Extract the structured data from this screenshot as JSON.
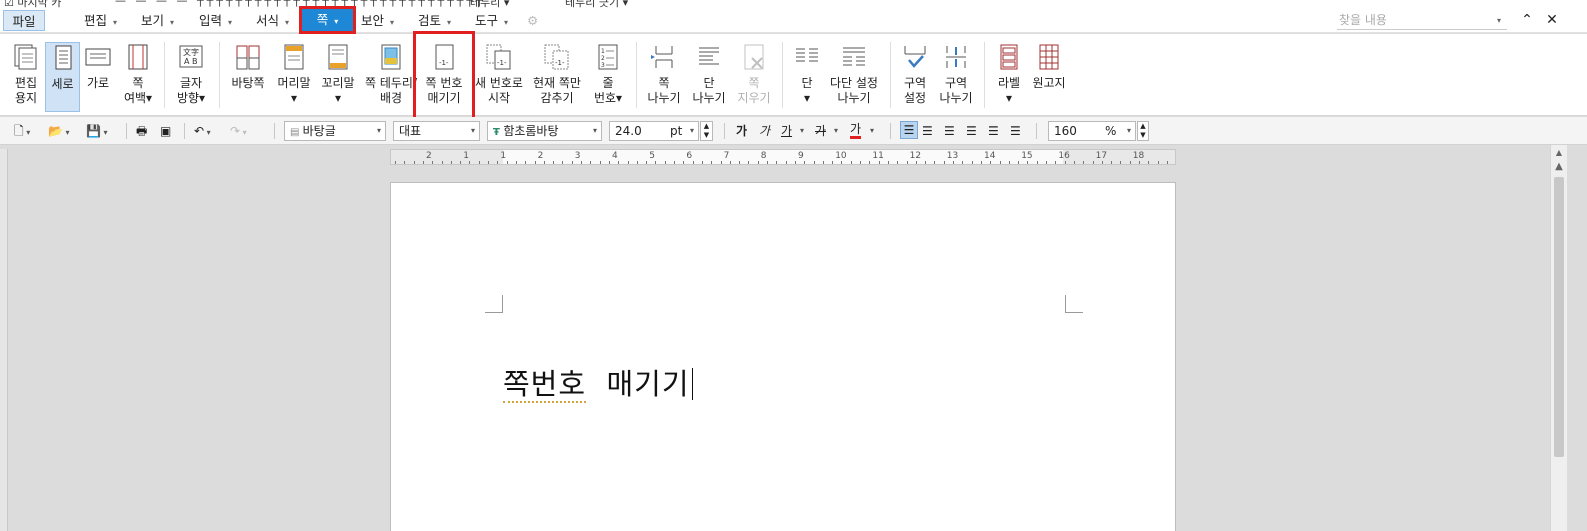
{
  "topstrip": {
    "left_text": "마지막 카",
    "mid_text": "테두리 ▾",
    "right_text": "테두리 긋기 ▾"
  },
  "menubar": {
    "file": "파일",
    "items": [
      {
        "label": "편집"
      },
      {
        "label": "보기"
      },
      {
        "label": "입력"
      },
      {
        "label": "서식"
      },
      {
        "label": "쪽"
      },
      {
        "label": "보안"
      },
      {
        "label": "검토"
      },
      {
        "label": "도구"
      }
    ],
    "search_placeholder": "찾을 내용",
    "dropdown_glyph": "▾",
    "collapse_glyph": "⌃",
    "close_glyph": "✕"
  },
  "ribbon": {
    "edit_paper": [
      "편집",
      "용지"
    ],
    "sero": "세로",
    "garo": "가로",
    "margin": [
      "쪽",
      "여백▾"
    ],
    "text_dir": [
      "글자",
      "방향▾"
    ],
    "batang": "바탕쪽",
    "header": [
      "머리말",
      "▾"
    ],
    "footer": [
      "꼬리말",
      "▾"
    ],
    "border_bg": [
      "쪽 테두리/",
      "배경"
    ],
    "page_num": [
      "쪽 번호",
      "매기기"
    ],
    "new_num": [
      "새 번호로",
      "시작"
    ],
    "hide_cur": [
      "현재 쪽만",
      "감추기"
    ],
    "line_num": [
      "줄",
      "번호▾"
    ],
    "page_break": [
      "쪽",
      "나누기"
    ],
    "col_break": [
      "단",
      "나누기"
    ],
    "page_erase": [
      "쪽",
      "지우기"
    ],
    "column": [
      "단",
      "▾"
    ],
    "multi_col": [
      "다단 설정",
      "나누기"
    ],
    "section_set": [
      "구역",
      "설정"
    ],
    "section_break": [
      "구역",
      "나누기"
    ],
    "label": [
      "라벨",
      "▾"
    ],
    "manuscript": "원고지"
  },
  "toolbar": {
    "style": "바탕글",
    "lang": "대표",
    "font": "함초롬바탕",
    "size": "24.0",
    "unit": "pt",
    "zoom": "160",
    "zoom_unit": "%",
    "bold": "가",
    "italic": "가",
    "underline": "가",
    "strike": "가",
    "color": "가",
    "dd": "▾"
  },
  "ruler": {
    "numbers": [
      "2",
      "1",
      "1",
      "2",
      "3",
      "4",
      "5",
      "6",
      "7",
      "8",
      "9",
      "10",
      "11",
      "12",
      "13",
      "14",
      "15",
      "16",
      "17",
      "18"
    ]
  },
  "document": {
    "word1": "쪽번호",
    "word2": "매기기"
  },
  "colors": {
    "accent": "#1e88d6",
    "highlight": "#e02020"
  }
}
